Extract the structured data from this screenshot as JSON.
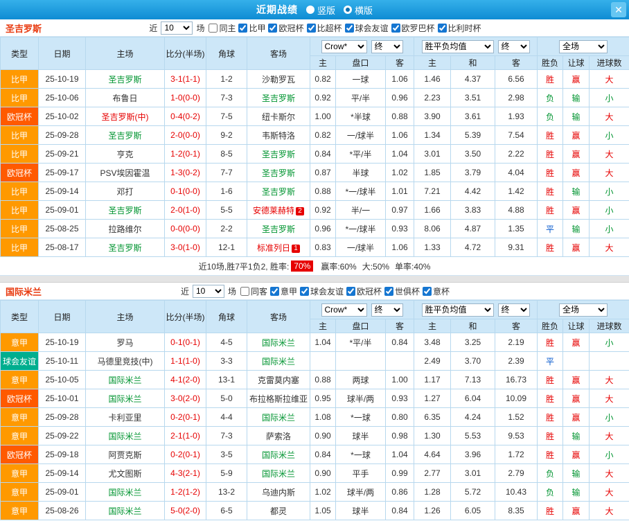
{
  "topbar": {
    "title": "近期战绩",
    "vertical_label": "竖版",
    "horizontal_label": "横版",
    "selected": "横版"
  },
  "icons": {
    "close": "✕"
  },
  "colors": {
    "accent_blue": "#1798dd",
    "win_red": "#e60000",
    "lose_green": "#009430",
    "draw_blue": "#0055cc",
    "league_orange": "#ff9900",
    "league_red": "#ff5a00",
    "league_teal": "#00ae8e"
  },
  "table_header": {
    "col_type": "类型",
    "col_date": "日期",
    "col_home": "主场",
    "col_score": "比分(半场)",
    "col_corner": "角球",
    "col_away": "客场",
    "odds_select": "Crow*",
    "odds_final": "终",
    "avg_select": "胜平负均值",
    "avg_final": "终",
    "scope_select": "全场",
    "sub": [
      "主",
      "盘口",
      "客",
      "主",
      "和",
      "客",
      "胜负",
      "让球",
      "进球数"
    ]
  },
  "sections": [
    {
      "team": "圣吉罗斯",
      "filter": {
        "near_label": "近",
        "games": "10",
        "games_label": "场",
        "same_label": "同主",
        "same_checked": false,
        "leagues": [
          {
            "label": "比甲",
            "checked": true
          },
          {
            "label": "欧冠杯",
            "checked": true
          },
          {
            "label": "比超杯",
            "checked": true
          },
          {
            "label": "球会友谊",
            "checked": true
          },
          {
            "label": "欧罗巴杯",
            "checked": true
          },
          {
            "label": "比利时杯",
            "checked": true
          }
        ]
      },
      "rows": [
        {
          "lg": "比甲",
          "date": "25-10-19",
          "home": {
            "t": "圣吉罗斯",
            "c": "g"
          },
          "score": "3-1(1-1)",
          "corner": "1-2",
          "away": {
            "t": "沙勒罗瓦",
            "c": "k"
          },
          "o1": "0.82",
          "o2": "一球",
          "o3": "1.06",
          "a1": "1.46",
          "a2": "4.37",
          "a3": "6.56",
          "r1": "胜",
          "r2": "赢",
          "r3": "大"
        },
        {
          "lg": "比甲",
          "date": "25-10-06",
          "home": {
            "t": "布鲁日",
            "c": "k"
          },
          "score": "1-0(0-0)",
          "corner": "7-3",
          "away": {
            "t": "圣吉罗斯",
            "c": "g"
          },
          "o1": "0.92",
          "o2": "平/半",
          "o3": "0.96",
          "a1": "2.23",
          "a2": "3.51",
          "a3": "2.98",
          "r1": "负",
          "r2": "输",
          "r3": "小"
        },
        {
          "lg": "欧冠杯",
          "date": "25-10-02",
          "home": {
            "t": "圣吉罗斯(中)",
            "c": "r"
          },
          "score": "0-4(0-2)",
          "corner": "7-5",
          "away": {
            "t": "纽卡斯尔",
            "c": "k"
          },
          "o1": "1.00",
          "o2": "*半球",
          "o3": "0.88",
          "a1": "3.90",
          "a2": "3.61",
          "a3": "1.93",
          "r1": "负",
          "r2": "输",
          "r3": "大"
        },
        {
          "lg": "比甲",
          "date": "25-09-28",
          "home": {
            "t": "圣吉罗斯",
            "c": "g"
          },
          "score": "2-0(0-0)",
          "corner": "9-2",
          "away": {
            "t": "韦斯特洛",
            "c": "k"
          },
          "o1": "0.82",
          "o2": "一/球半",
          "o3": "1.06",
          "a1": "1.34",
          "a2": "5.39",
          "a3": "7.54",
          "r1": "胜",
          "r2": "赢",
          "r3": "小"
        },
        {
          "lg": "比甲",
          "date": "25-09-21",
          "home": {
            "t": "亨克",
            "c": "k"
          },
          "score": "1-2(0-1)",
          "corner": "8-5",
          "away": {
            "t": "圣吉罗斯",
            "c": "g"
          },
          "o1": "0.84",
          "o2": "*平/半",
          "o3": "1.04",
          "a1": "3.01",
          "a2": "3.50",
          "a3": "2.22",
          "r1": "胜",
          "r2": "赢",
          "r3": "大"
        },
        {
          "lg": "欧冠杯",
          "date": "25-09-17",
          "home": {
            "t": "PSV埃因霍温",
            "c": "k"
          },
          "score": "1-3(0-2)",
          "corner": "7-7",
          "away": {
            "t": "圣吉罗斯",
            "c": "g"
          },
          "o1": "0.87",
          "o2": "半球",
          "o3": "1.02",
          "a1": "1.85",
          "a2": "3.79",
          "a3": "4.04",
          "r1": "胜",
          "r2": "赢",
          "r3": "大"
        },
        {
          "lg": "比甲",
          "date": "25-09-14",
          "home": {
            "t": "邓打",
            "c": "k"
          },
          "score": "0-1(0-0)",
          "corner": "1-6",
          "away": {
            "t": "圣吉罗斯",
            "c": "g"
          },
          "o1": "0.88",
          "o2": "*一/球半",
          "o3": "1.01",
          "a1": "7.21",
          "a2": "4.42",
          "a3": "1.42",
          "r1": "胜",
          "r2": "输",
          "r3": "小"
        },
        {
          "lg": "比甲",
          "date": "25-09-01",
          "home": {
            "t": "圣吉罗斯",
            "c": "g"
          },
          "score": "2-0(1-0)",
          "corner": "5-5",
          "away": {
            "t": "安德莱赫特",
            "c": "r",
            "b": "2"
          },
          "o1": "0.92",
          "o2": "半/一",
          "o3": "0.97",
          "a1": "1.66",
          "a2": "3.83",
          "a3": "4.88",
          "r1": "胜",
          "r2": "赢",
          "r3": "小"
        },
        {
          "lg": "比甲",
          "date": "25-08-25",
          "home": {
            "t": "拉路维尔",
            "c": "k"
          },
          "score": "0-0(0-0)",
          "corner": "2-2",
          "away": {
            "t": "圣吉罗斯",
            "c": "g"
          },
          "o1": "0.96",
          "o2": "*一/球半",
          "o3": "0.93",
          "a1": "8.06",
          "a2": "4.87",
          "a3": "1.35",
          "r1": "平",
          "r2": "输",
          "r3": "小"
        },
        {
          "lg": "比甲",
          "date": "25-08-17",
          "home": {
            "t": "圣吉罗斯",
            "c": "g"
          },
          "score": "3-0(1-0)",
          "corner": "12-1",
          "away": {
            "t": "标准列日",
            "c": "r",
            "b": "1"
          },
          "o1": "0.83",
          "o2": "一/球半",
          "o3": "1.06",
          "a1": "1.33",
          "a2": "4.72",
          "a3": "9.31",
          "r1": "胜",
          "r2": "赢",
          "r3": "大"
        }
      ],
      "summary": {
        "prefix": "近10场,胜7平1负2, 胜率:",
        "win_rate": "70%",
        "stats": [
          "赢率:60%",
          "大:50%",
          "单率:40%"
        ]
      }
    },
    {
      "team": "国际米兰",
      "filter": {
        "near_label": "近",
        "games": "10",
        "games_label": "场",
        "same_label": "同客",
        "same_checked": false,
        "leagues": [
          {
            "label": "意甲",
            "checked": true
          },
          {
            "label": "球会友谊",
            "checked": true
          },
          {
            "label": "欧冠杯",
            "checked": true
          },
          {
            "label": "世俱杯",
            "checked": true
          },
          {
            "label": "意杯",
            "checked": true
          }
        ]
      },
      "rows": [
        {
          "lg": "意甲",
          "date": "25-10-19",
          "home": {
            "t": "罗马",
            "c": "k"
          },
          "score": "0-1(0-1)",
          "corner": "4-5",
          "away": {
            "t": "国际米兰",
            "c": "g"
          },
          "o1": "1.04",
          "o2": "*平/半",
          "o3": "0.84",
          "a1": "3.48",
          "a2": "3.25",
          "a3": "2.19",
          "r1": "胜",
          "r2": "赢",
          "r3": "小"
        },
        {
          "lg": "球会友谊",
          "date": "25-10-11",
          "home": {
            "t": "马德里竞技(中)",
            "c": "k"
          },
          "score": "1-1(1-0)",
          "corner": "3-3",
          "away": {
            "t": "国际米兰",
            "c": "g"
          },
          "o1": "",
          "o2": "",
          "o3": "",
          "a1": "2.49",
          "a2": "3.70",
          "a3": "2.39",
          "r1": "平",
          "r2": "",
          "r3": ""
        },
        {
          "lg": "意甲",
          "date": "25-10-05",
          "home": {
            "t": "国际米兰",
            "c": "g"
          },
          "score": "4-1(2-0)",
          "corner": "13-1",
          "away": {
            "t": "克雷莫内塞",
            "c": "k"
          },
          "o1": "0.88",
          "o2": "两球",
          "o3": "1.00",
          "a1": "1.17",
          "a2": "7.13",
          "a3": "16.73",
          "r1": "胜",
          "r2": "赢",
          "r3": "大"
        },
        {
          "lg": "欧冠杯",
          "date": "25-10-01",
          "home": {
            "t": "国际米兰",
            "c": "g"
          },
          "score": "3-0(2-0)",
          "corner": "5-0",
          "away": {
            "t": "布拉格斯拉维亚",
            "c": "k"
          },
          "o1": "0.95",
          "o2": "球半/两",
          "o3": "0.93",
          "a1": "1.27",
          "a2": "6.04",
          "a3": "10.09",
          "r1": "胜",
          "r2": "赢",
          "r3": "大"
        },
        {
          "lg": "意甲",
          "date": "25-09-28",
          "home": {
            "t": "卡利亚里",
            "c": "k"
          },
          "score": "0-2(0-1)",
          "corner": "4-4",
          "away": {
            "t": "国际米兰",
            "c": "g"
          },
          "o1": "1.08",
          "o2": "*一球",
          "o3": "0.80",
          "a1": "6.35",
          "a2": "4.24",
          "a3": "1.52",
          "r1": "胜",
          "r2": "赢",
          "r3": "小"
        },
        {
          "lg": "意甲",
          "date": "25-09-22",
          "home": {
            "t": "国际米兰",
            "c": "g"
          },
          "score": "2-1(1-0)",
          "corner": "7-3",
          "away": {
            "t": "萨索洛",
            "c": "k"
          },
          "o1": "0.90",
          "o2": "球半",
          "o3": "0.98",
          "a1": "1.30",
          "a2": "5.53",
          "a3": "9.53",
          "r1": "胜",
          "r2": "输",
          "r3": "大"
        },
        {
          "lg": "欧冠杯",
          "date": "25-09-18",
          "home": {
            "t": "阿贾克斯",
            "c": "k"
          },
          "score": "0-2(0-1)",
          "corner": "3-5",
          "away": {
            "t": "国际米兰",
            "c": "g"
          },
          "o1": "0.84",
          "o2": "*一球",
          "o3": "1.04",
          "a1": "4.64",
          "a2": "3.96",
          "a3": "1.72",
          "r1": "胜",
          "r2": "赢",
          "r3": "小"
        },
        {
          "lg": "意甲",
          "date": "25-09-14",
          "home": {
            "t": "尤文图斯",
            "c": "k"
          },
          "score": "4-3(2-1)",
          "corner": "5-9",
          "away": {
            "t": "国际米兰",
            "c": "g"
          },
          "o1": "0.90",
          "o2": "平手",
          "o3": "0.99",
          "a1": "2.77",
          "a2": "3.01",
          "a3": "2.79",
          "r1": "负",
          "r2": "输",
          "r3": "大"
        },
        {
          "lg": "意甲",
          "date": "25-09-01",
          "home": {
            "t": "国际米兰",
            "c": "g"
          },
          "score": "1-2(1-2)",
          "corner": "13-2",
          "away": {
            "t": "乌迪内斯",
            "c": "k"
          },
          "o1": "1.02",
          "o2": "球半/两",
          "o3": "0.86",
          "a1": "1.28",
          "a2": "5.72",
          "a3": "10.43",
          "r1": "负",
          "r2": "输",
          "r3": "大"
        },
        {
          "lg": "意甲",
          "date": "25-08-26",
          "home": {
            "t": "国际米兰",
            "c": "g"
          },
          "score": "5-0(2-0)",
          "corner": "6-5",
          "away": {
            "t": "都灵",
            "c": "k"
          },
          "o1": "1.05",
          "o2": "球半",
          "o3": "0.84",
          "a1": "1.26",
          "a2": "6.05",
          "a3": "8.35",
          "r1": "胜",
          "r2": "赢",
          "r3": "大"
        }
      ]
    }
  ]
}
